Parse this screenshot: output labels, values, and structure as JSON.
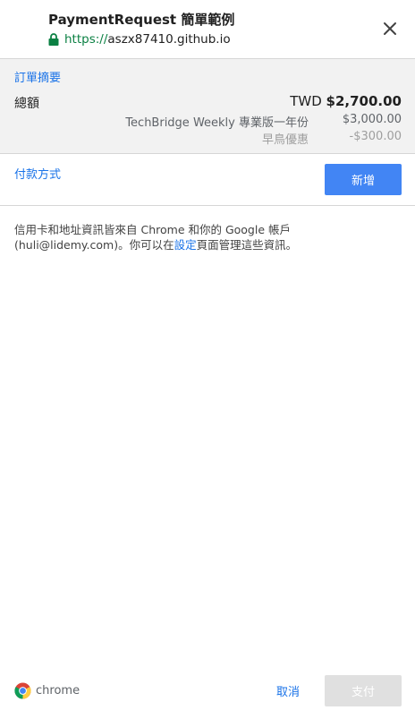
{
  "header": {
    "title": "PaymentRequest 簡單範例",
    "url_scheme": "https://",
    "url_host": "aszx87410.github.io"
  },
  "summary": {
    "section_label": "訂單摘要",
    "total_label": "總額",
    "total_currency": "TWD",
    "total_amount": "$2,700.00",
    "items": [
      {
        "label": "TechBridge Weekly 專業版一年份",
        "amount": "$3,000.00"
      },
      {
        "label": "早鳥優惠",
        "amount": "-$300.00"
      }
    ]
  },
  "payment": {
    "section_label": "付款方式",
    "add_label": "新增"
  },
  "info": {
    "text_before": "信用卡和地址資訊皆來自 Chrome 和你的 Google 帳戶 (huli@lidemy.com)。你可以在",
    "link_text": "設定",
    "text_after": "頁面管理這些資訊。"
  },
  "footer": {
    "brand": "chrome",
    "cancel_label": "取消",
    "pay_label": "支付"
  },
  "colors": {
    "accent": "#4285f4",
    "link": "#1a73e8",
    "secure": "#0b8043",
    "summary_bg": "#f2f2f2",
    "disabled": "#e0e0e0"
  },
  "icons": [
    "lock-icon",
    "close-icon",
    "chrome-logo-icon"
  ]
}
